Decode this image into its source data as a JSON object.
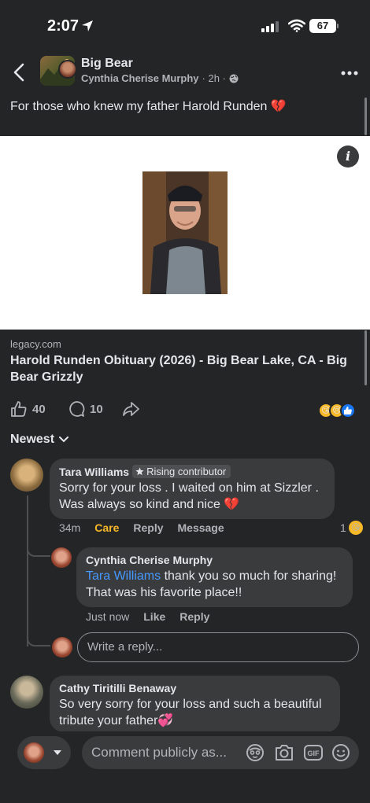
{
  "status_bar": {
    "time": "2:07",
    "battery": "67"
  },
  "header": {
    "group_name": "Big Bear",
    "author": "Cynthia Cherise Murphy",
    "meta": "· 2h ·"
  },
  "post": {
    "text": "For those who knew my father Harold Runden 💔"
  },
  "link": {
    "domain": "legacy.com",
    "title": "Harold Runden Obituary (2026) - Big Bear Lake, CA - Big Bear Grizzly"
  },
  "actions": {
    "likes": "40",
    "comments": "10"
  },
  "sort": {
    "label": "Newest"
  },
  "comments": [
    {
      "name": "Tara Williams",
      "badge": "Rising contributor",
      "text": "Sorry for your loss . I waited on him at Sizzler . Was always so kind and nice 💔",
      "time": "34m",
      "care": "Care",
      "reply": "Reply",
      "message": "Message",
      "reaction_count": "1"
    },
    {
      "name": "Cynthia Cherise Murphy",
      "mention": "Tara Williams",
      "text": " thank you so much for sharing! That was his favorite place!!",
      "time": "Just now",
      "like": "Like",
      "reply": "Reply"
    },
    {
      "name": "Cathy Tiritilli Benaway",
      "text": "So very sorry for your loss and such a beautiful tribute your father💞"
    }
  ],
  "reply_box": {
    "placeholder": "Write a reply..."
  },
  "composer": {
    "placeholder": "Comment publicly as..."
  },
  "icons": [
    "back-icon",
    "more-icon",
    "globe-icon",
    "info-icon",
    "like-icon",
    "comment-icon",
    "share-icon",
    "chevron-down-icon",
    "camera-icon",
    "gif-icon",
    "emoji-icon",
    "avatar-sticker-icon"
  ],
  "colors": {
    "background": "#242526",
    "bubble": "#3a3b3c",
    "mention": "#4599ff",
    "care": "#f7b928"
  }
}
